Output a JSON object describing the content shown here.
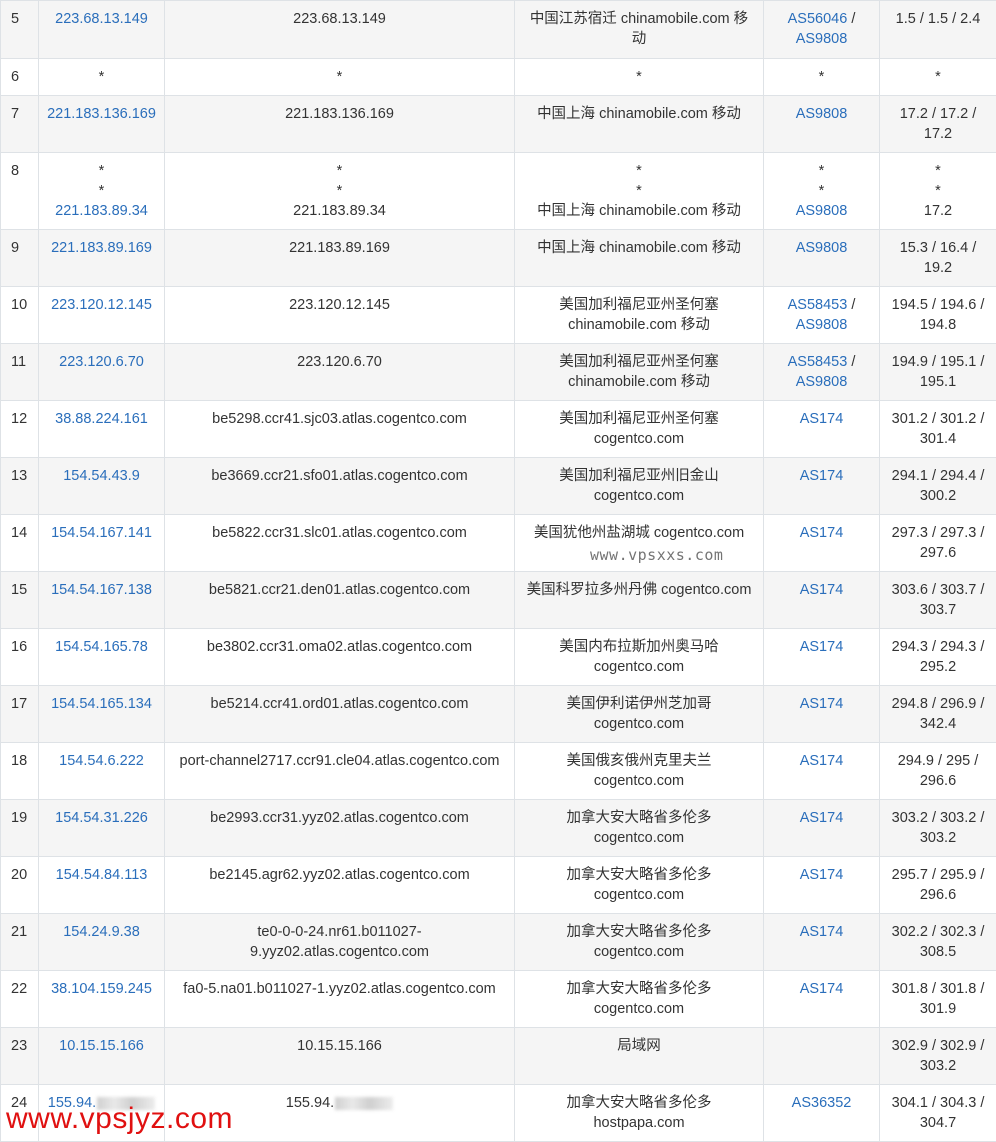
{
  "rows": [
    {
      "hop": "5",
      "ip": "223.68.13.149",
      "host": "223.68.13.149",
      "geo": [
        "中国江苏宿迁 chinamobile.com 移",
        "动"
      ],
      "asn": [
        [
          "AS56046",
          " /"
        ],
        [
          "AS9808",
          ""
        ]
      ],
      "rtt": [
        "1.5 / 1.5 / 2.4"
      ]
    },
    {
      "hop": "6",
      "ip_text": "*",
      "host": "*",
      "geo": [
        "*"
      ],
      "asn_text": "*",
      "rtt": [
        "*"
      ]
    },
    {
      "hop": "7",
      "ip": "221.183.136.169",
      "host": "221.183.136.169",
      "geo": [
        "中国上海 chinamobile.com 移动"
      ],
      "asn": [
        [
          "AS9808",
          ""
        ]
      ],
      "rtt": [
        "17.2 / 17.2 /",
        "17.2"
      ]
    },
    {
      "hop": "8",
      "ip_pre": [
        "*",
        "*"
      ],
      "ip": "221.183.89.34",
      "host_lines": [
        "*",
        "*",
        "221.183.89.34"
      ],
      "geo": [
        "*",
        "*",
        "中国上海 chinamobile.com 移动"
      ],
      "asn_pre": [
        "*",
        "*"
      ],
      "asn": [
        [
          "AS9808",
          ""
        ]
      ],
      "rtt": [
        "*",
        "*",
        "17.2"
      ]
    },
    {
      "hop": "9",
      "ip": "221.183.89.169",
      "host": "221.183.89.169",
      "geo": [
        "中国上海 chinamobile.com 移动"
      ],
      "asn": [
        [
          "AS9808",
          ""
        ]
      ],
      "rtt": [
        "15.3 / 16.4 /",
        "19.2"
      ]
    },
    {
      "hop": "10",
      "ip": "223.120.12.145",
      "host": "223.120.12.145",
      "geo": [
        "美国加利福尼亚州圣何塞",
        "chinamobile.com 移动"
      ],
      "asn": [
        [
          "AS58453",
          " /"
        ],
        [
          "AS9808",
          ""
        ]
      ],
      "rtt": [
        "194.5 / 194.6 /",
        "194.8"
      ]
    },
    {
      "hop": "11",
      "ip": "223.120.6.70",
      "host": "223.120.6.70",
      "geo": [
        "美国加利福尼亚州圣何塞",
        "chinamobile.com 移动"
      ],
      "asn": [
        [
          "AS58453",
          " /"
        ],
        [
          "AS9808",
          ""
        ]
      ],
      "rtt": [
        "194.9 / 195.1 /",
        "195.1"
      ]
    },
    {
      "hop": "12",
      "ip": "38.88.224.161",
      "host": "be5298.ccr41.sjc03.atlas.cogentco.com",
      "geo": [
        "美国加利福尼亚州圣何塞",
        "cogentco.com"
      ],
      "asn": [
        [
          "AS174",
          ""
        ]
      ],
      "rtt": [
        "301.2 / 301.2 /",
        "301.4"
      ]
    },
    {
      "hop": "13",
      "ip": "154.54.43.9",
      "host": "be3669.ccr21.sfo01.atlas.cogentco.com",
      "geo": [
        "美国加利福尼亚州旧金山",
        "cogentco.com"
      ],
      "asn": [
        [
          "AS174",
          ""
        ]
      ],
      "rtt": [
        "294.1 / 294.4 /",
        "300.2"
      ]
    },
    {
      "hop": "14",
      "ip": "154.54.167.141",
      "host": "be5822.ccr31.slc01.atlas.cogentco.com",
      "geo": [
        "美国犹他州盐湖城 cogentco.com"
      ],
      "asn": [
        [
          "AS174",
          ""
        ]
      ],
      "rtt": [
        "297.3 / 297.3 /",
        "297.6"
      ]
    },
    {
      "hop": "15",
      "ip": "154.54.167.138",
      "host": "be5821.ccr21.den01.atlas.cogentco.com",
      "geo": [
        "美国科罗拉多州丹佛 cogentco.com"
      ],
      "asn": [
        [
          "AS174",
          ""
        ]
      ],
      "rtt": [
        "303.6 / 303.7 /",
        "303.7"
      ]
    },
    {
      "hop": "16",
      "ip": "154.54.165.78",
      "host": "be3802.ccr31.oma02.atlas.cogentco.com",
      "geo": [
        "美国内布拉斯加州奥马哈",
        "cogentco.com"
      ],
      "asn": [
        [
          "AS174",
          ""
        ]
      ],
      "rtt": [
        "294.3 / 294.3 /",
        "295.2"
      ]
    },
    {
      "hop": "17",
      "ip": "154.54.165.134",
      "host": "be5214.ccr41.ord01.atlas.cogentco.com",
      "geo": [
        "美国伊利诺伊州芝加哥",
        "cogentco.com"
      ],
      "asn": [
        [
          "AS174",
          ""
        ]
      ],
      "rtt": [
        "294.8 / 296.9 /",
        "342.4"
      ]
    },
    {
      "hop": "18",
      "ip": "154.54.6.222",
      "host": "port-channel2717.ccr91.cle04.atlas.cogentco.com",
      "geo": [
        "美国俄亥俄州克里夫兰",
        "cogentco.com"
      ],
      "asn": [
        [
          "AS174",
          ""
        ]
      ],
      "rtt": [
        "294.9 / 295 /",
        "296.6"
      ]
    },
    {
      "hop": "19",
      "ip": "154.54.31.226",
      "host": "be2993.ccr31.yyz02.atlas.cogentco.com",
      "geo": [
        "加拿大安大略省多伦多",
        "cogentco.com"
      ],
      "asn": [
        [
          "AS174",
          ""
        ]
      ],
      "rtt": [
        "303.2 / 303.2 /",
        "303.2"
      ]
    },
    {
      "hop": "20",
      "ip": "154.54.84.113",
      "host": "be2145.agr62.yyz02.atlas.cogentco.com",
      "geo": [
        "加拿大安大略省多伦多",
        "cogentco.com"
      ],
      "asn": [
        [
          "AS174",
          ""
        ]
      ],
      "rtt": [
        "295.7 / 295.9 /",
        "296.6"
      ]
    },
    {
      "hop": "21",
      "ip": "154.24.9.38",
      "host_lines": [
        "te0-0-0-24.nr61.b011027-",
        "9.yyz02.atlas.cogentco.com"
      ],
      "geo": [
        "加拿大安大略省多伦多",
        "cogentco.com"
      ],
      "asn": [
        [
          "AS174",
          ""
        ]
      ],
      "rtt": [
        "302.2 / 302.3 /",
        "308.5"
      ]
    },
    {
      "hop": "22",
      "ip": "38.104.159.245",
      "host": "fa0-5.na01.b011027-1.yyz02.atlas.cogentco.com",
      "geo": [
        "加拿大安大略省多伦多",
        "cogentco.com"
      ],
      "asn": [
        [
          "AS174",
          ""
        ]
      ],
      "rtt": [
        "301.8 / 301.8 /",
        "301.9"
      ]
    },
    {
      "hop": "23",
      "ip": "10.15.15.166",
      "host": "10.15.15.166",
      "geo": [
        "局域网"
      ],
      "asn": [],
      "rtt": [
        "302.9 / 302.9 /",
        "303.2"
      ]
    },
    {
      "hop": "24",
      "ip": "155.94.",
      "ip_blurred": true,
      "host": "155.94.",
      "host_blurred": true,
      "geo": [
        "加拿大安大略省多伦多",
        "hostpapa.com"
      ],
      "asn": [
        [
          "AS36352",
          ""
        ]
      ],
      "rtt": [
        "304.1 / 304.3 /",
        "304.7"
      ]
    }
  ],
  "watermark_mid": "www.vpsxxs.com",
  "watermark_corner": "www.vpsjyz.com",
  "colors": {
    "link": "#2a6ebb",
    "stripe": "#f5f5f5",
    "border": "#dee2e6",
    "watermark_corner": "#e01010"
  }
}
